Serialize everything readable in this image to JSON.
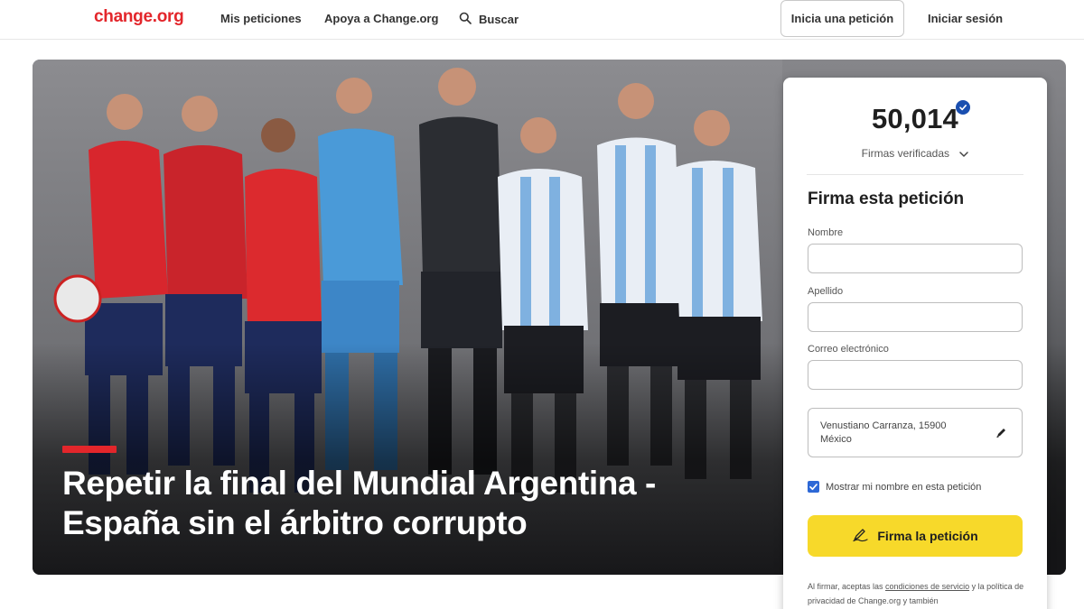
{
  "nav": {
    "logo": "change.org",
    "links": [
      "Mis peticiones",
      "Apoya a Change.org",
      "Buscar"
    ],
    "start_button": "Inicia una petición",
    "login": "Iniciar sesión"
  },
  "hero": {
    "title": "Repetir la final del Mundial Argentina - España sin el árbitro corrupto",
    "image": "team-players-photo",
    "accent_color": "#e3262b"
  },
  "card": {
    "count": "50,014",
    "verified_label": "Firmas verificadas",
    "title": "Firma esta petición",
    "fields": {
      "first_name_label": "Nombre",
      "first_name_value": "",
      "last_name_label": "Apellido",
      "last_name_value": "",
      "email_label": "Correo electrónico",
      "email_value": ""
    },
    "address_line1": "Venustiano Carranza, 15900",
    "address_line2": "México",
    "show_name_label": "Mostrar mi nombre en esta petición",
    "show_name_checked": true,
    "sign_button": "Firma la petición",
    "legal_pre": "Al firmar, aceptas las ",
    "legal_link": "condiciones de servicio",
    "legal_post": " y la política de privacidad de Change.org y también"
  },
  "colors": {
    "brand": "#e3262b",
    "sign_button": "#f7d92a",
    "verified": "#1a4fb0"
  }
}
